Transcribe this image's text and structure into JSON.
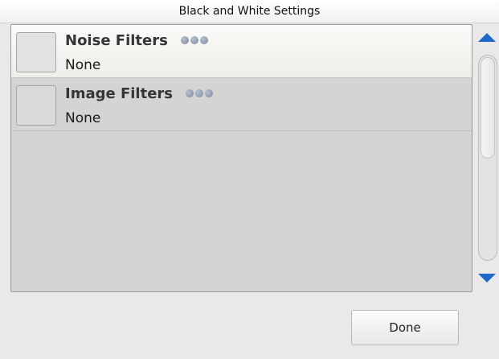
{
  "window": {
    "title": "Black and White Settings"
  },
  "settings": [
    {
      "label": "Noise Filters",
      "value": "None",
      "selected": true,
      "more_icon": "more-dots-icon"
    },
    {
      "label": "Image Filters",
      "value": "None",
      "selected": false,
      "more_icon": "more-dots-icon"
    }
  ],
  "scrollbar": {
    "up_icon": "arrow-up-icon",
    "down_icon": "arrow-down-icon"
  },
  "footer": {
    "done_label": "Done"
  },
  "colors": {
    "accent": "#1f67c8",
    "panel_bg": "#d4d4d4",
    "selected_row_bg": "#f4f3ef"
  }
}
